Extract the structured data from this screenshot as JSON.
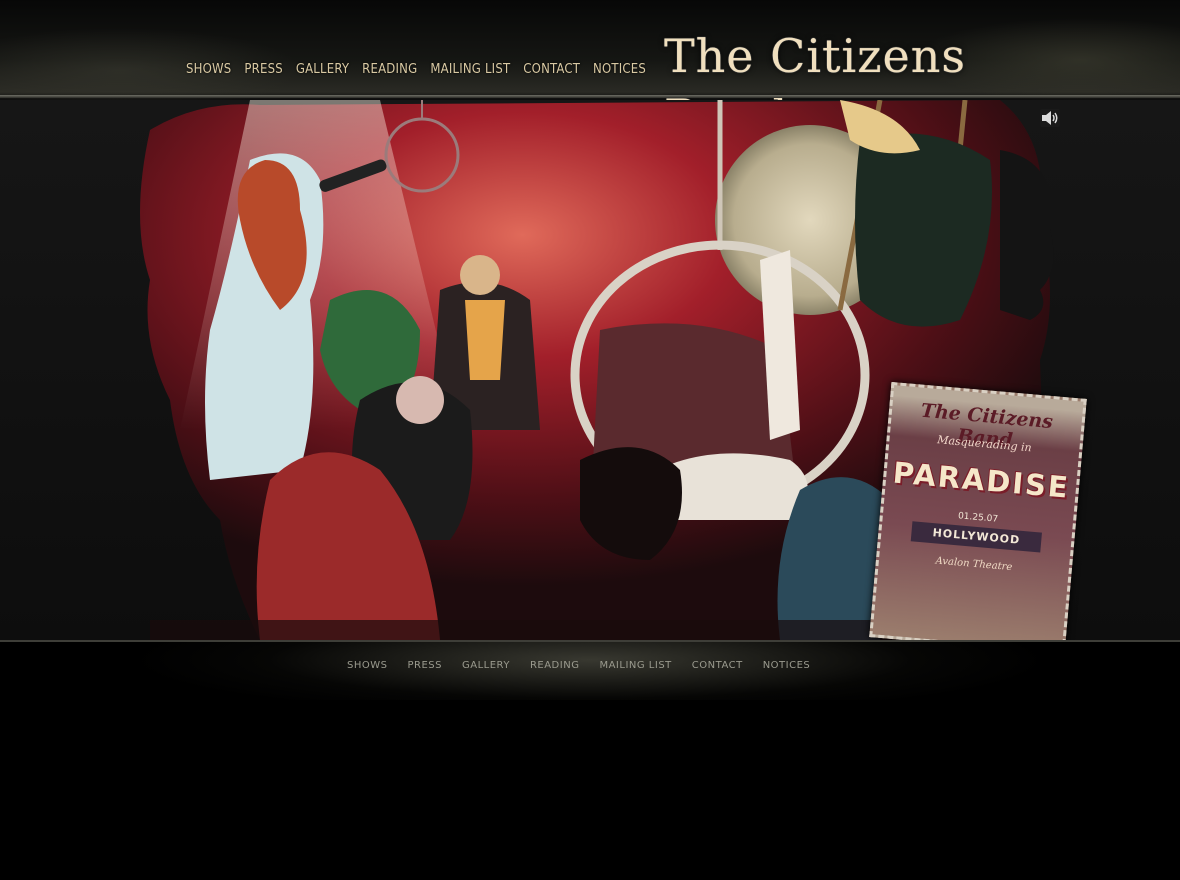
{
  "site": {
    "brand": "The Citizens Band"
  },
  "nav_top": [
    "SHOWS",
    "PRESS",
    "GALLERY",
    "READING",
    "MAILING LIST",
    "CONTACT",
    "NOTICES"
  ],
  "nav_bottom": [
    "SHOWS",
    "PRESS",
    "GALLERY",
    "READING",
    "MAILING LIST",
    "CONTACT",
    "NOTICES"
  ],
  "poster": {
    "title": "The Citizens Band",
    "subtitle": "Masquerading in",
    "headline": "PARADISE",
    "date": "01.25.07",
    "city": "HOLLYWOOD",
    "venue": "Avalon Theatre"
  },
  "icons": {
    "sound": "speaker-icon"
  },
  "colors": {
    "nav_gold": "#d9c9a3",
    "brand_cream": "#f0dfbe",
    "footer_nav": "#9a9a8e"
  }
}
